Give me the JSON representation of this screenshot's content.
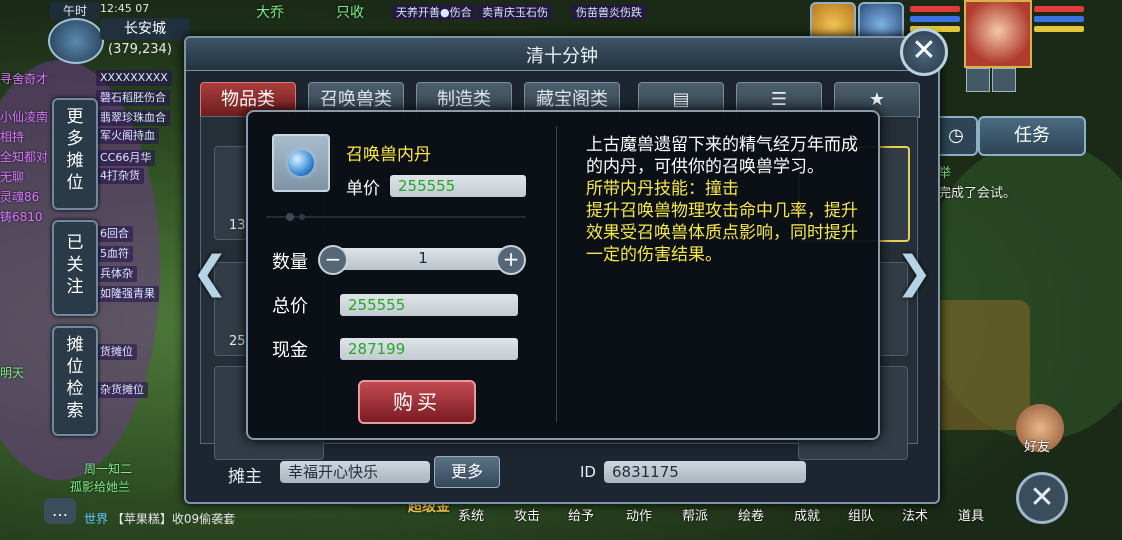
{
  "hud": {
    "time_label": "午时",
    "clock": "12:45 07",
    "city": "长安城",
    "coords": "(379,234)"
  },
  "side_tabs": [
    {
      "label": "更多摊位"
    },
    {
      "label": "已关注"
    },
    {
      "label": "摊位检索"
    }
  ],
  "left_chat": [
    "XXXXXXXXX",
    "磬石稻胚伤合",
    "翡翠珍珠血合",
    "军火阁持血",
    "CC66月华",
    "4打杂货",
    "6回合",
    "5血符",
    "兵体杂",
    "如隆强青果",
    "货摊位",
    "杂货摊位"
  ],
  "left_names": [
    "寻舍奇才",
    "小仙凌南",
    "相持",
    "全知都对",
    "灵魂86",
    "铸6810",
    "无聊",
    "明天",
    "周一知二",
    "孤影给她兰"
  ],
  "top_banners": [
    "大乔",
    "只收",
    "天养开善●伤合",
    "卖青庆玉石伤",
    "伤苗兽炎伤跌"
  ],
  "right_hud": {
    "task_button": "任务",
    "clock_icon": "clock-icon",
    "notice_1": "举",
    "notice_2": "完成了会试。",
    "friend": "好友"
  },
  "shop": {
    "title": "清十分钟",
    "tabs": [
      {
        "label": "物品类",
        "active": true
      },
      {
        "label": "召唤兽类",
        "active": false
      },
      {
        "label": "制造类",
        "active": false
      },
      {
        "label": "藏宝阁类",
        "active": false
      }
    ],
    "icon_tabs": [
      "book-icon",
      "list-icon",
      "star-icon"
    ],
    "owner_label": "摊主",
    "owner_name": "幸福开心快乐",
    "more_button": "更多",
    "id_label": "ID",
    "id_value": "6831175",
    "slot_numbers": [
      "13",
      "25"
    ]
  },
  "popup": {
    "item_name": "召唤兽内丹",
    "unit_price_label": "单价",
    "unit_price": "255555",
    "qty_label": "数量",
    "qty_value": "1",
    "qty_minus": "−",
    "qty_plus": "+",
    "total_label": "总价",
    "total": "255555",
    "cash_label": "现金",
    "cash": "287199",
    "buy_button": "购买",
    "description_white": "上古魔兽遗留下来的精气经万年而成的内丹，可供你的召唤兽学习。",
    "description_yellow": "所带内丹技能：撞击\n提升召唤兽物理攻击命中几率，提升效果受召唤兽体质点影响，同时提升一定的伤害结果。"
  },
  "bottom": {
    "chat_icon": "chat-bubble-icon",
    "world_tag": "世界",
    "world_msg": "【苹果糕】收09偷袭套",
    "promo": "超级金",
    "items": [
      "系统",
      "攻击",
      "给予",
      "动作",
      "帮派",
      "绘卷",
      "成就",
      "组队",
      "法术",
      "道具"
    ]
  },
  "colors": {
    "active_tab": "#a93d3d",
    "item_name": "#ffea4a",
    "price_text": "#23a829",
    "desc_yellow": "#f6e84a"
  }
}
